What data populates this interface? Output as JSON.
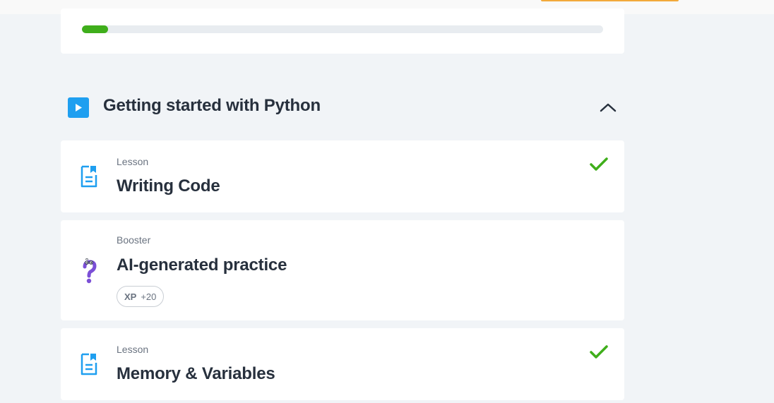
{
  "progress": {
    "fraction": 0.05
  },
  "colors": {
    "accent_blue": "#1f9ff0",
    "success_green": "#3fae1b",
    "booster_purple": "#7b4fd6",
    "top_accent": "#f2a93b"
  },
  "section": {
    "title": "Getting started with Python",
    "icon": "play-icon",
    "toggle_icon": "chevron-up-icon"
  },
  "items": [
    {
      "type": "Lesson",
      "title": "Writing Code",
      "icon": "lesson-icon",
      "completed": true
    },
    {
      "type": "Booster",
      "title": "AI-generated practice",
      "icon": "question-mascot-icon",
      "xp_label": "XP",
      "xp_value": "+20",
      "completed": false
    },
    {
      "type": "Lesson",
      "title": "Memory & Variables",
      "icon": "lesson-icon",
      "completed": true
    }
  ]
}
